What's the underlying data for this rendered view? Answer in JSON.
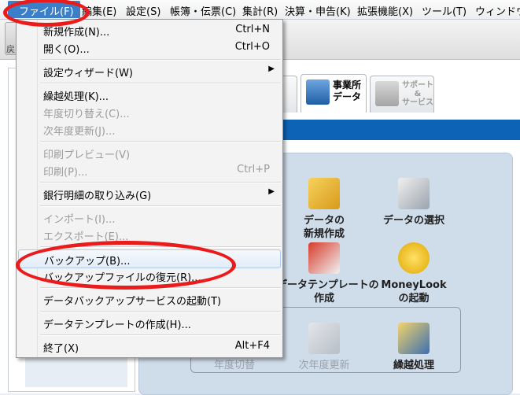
{
  "menubar": {
    "items": [
      "ファイル(F)",
      "編集(E)",
      "設定(S)",
      "帳簿・伝票(C)",
      "集計(R)",
      "決算・申告(K)",
      "拡張機能(X)",
      "ツール(T)",
      "ウィンドウ"
    ]
  },
  "toolbar": {
    "left_label": "戻"
  },
  "tabs": [
    {
      "label": "",
      "icon": "partial-tab"
    },
    {
      "label": "事業所\nデータ",
      "icon": "building-icon"
    },
    {
      "label": "サポート\n&\nサービス",
      "icon": "support-icon"
    }
  ],
  "tiles": [
    {
      "label": "データの\n新規作成",
      "icon": "new-data-icon"
    },
    {
      "label": "データの選択",
      "icon": "select-data-icon"
    },
    {
      "label": "データテンプレートの\n作成",
      "icon": "template-icon"
    },
    {
      "label": "MoneyLook\nの起動",
      "icon": "moneylook-icon"
    },
    {
      "label": "年度切替",
      "icon": "year-switch-icon"
    },
    {
      "label": "次年度更新",
      "icon": "next-year-icon"
    },
    {
      "label": "繰越処理",
      "icon": "carryover-icon"
    }
  ],
  "file_menu": {
    "items": [
      {
        "label": "新規作成(N)...",
        "shortcut": "Ctrl+N"
      },
      {
        "label": "開く(O)...",
        "shortcut": "Ctrl+O"
      },
      {
        "label": "設定ウィザード(W)",
        "shortcut": ""
      },
      {
        "label": "繰越処理(K)...",
        "shortcut": ""
      },
      {
        "label": "年度切り替え(C)...",
        "shortcut": ""
      },
      {
        "label": "次年度更新(J)...",
        "shortcut": ""
      },
      {
        "label": "印刷プレビュー(V)",
        "shortcut": ""
      },
      {
        "label": "印刷(P)...",
        "shortcut": "Ctrl+P"
      },
      {
        "label": "銀行明細の取り込み(G)",
        "shortcut": ""
      },
      {
        "label": "インポート(I)...",
        "shortcut": ""
      },
      {
        "label": "エクスポート(E)...",
        "shortcut": ""
      },
      {
        "label": "バックアップ(B)...",
        "shortcut": ""
      },
      {
        "label": "バックアップファイルの復元(R)...",
        "shortcut": ""
      },
      {
        "label": "データバックアップサービスの起動(T)",
        "shortcut": ""
      },
      {
        "label": "データテンプレートの作成(H)...",
        "shortcut": ""
      },
      {
        "label": "終了(X)",
        "shortcut": "Alt+F4"
      }
    ]
  },
  "colors": {
    "accent": "#0d63b6",
    "highlight_ring": "#ec1b1b",
    "menu_active": "#3c7fc9"
  }
}
